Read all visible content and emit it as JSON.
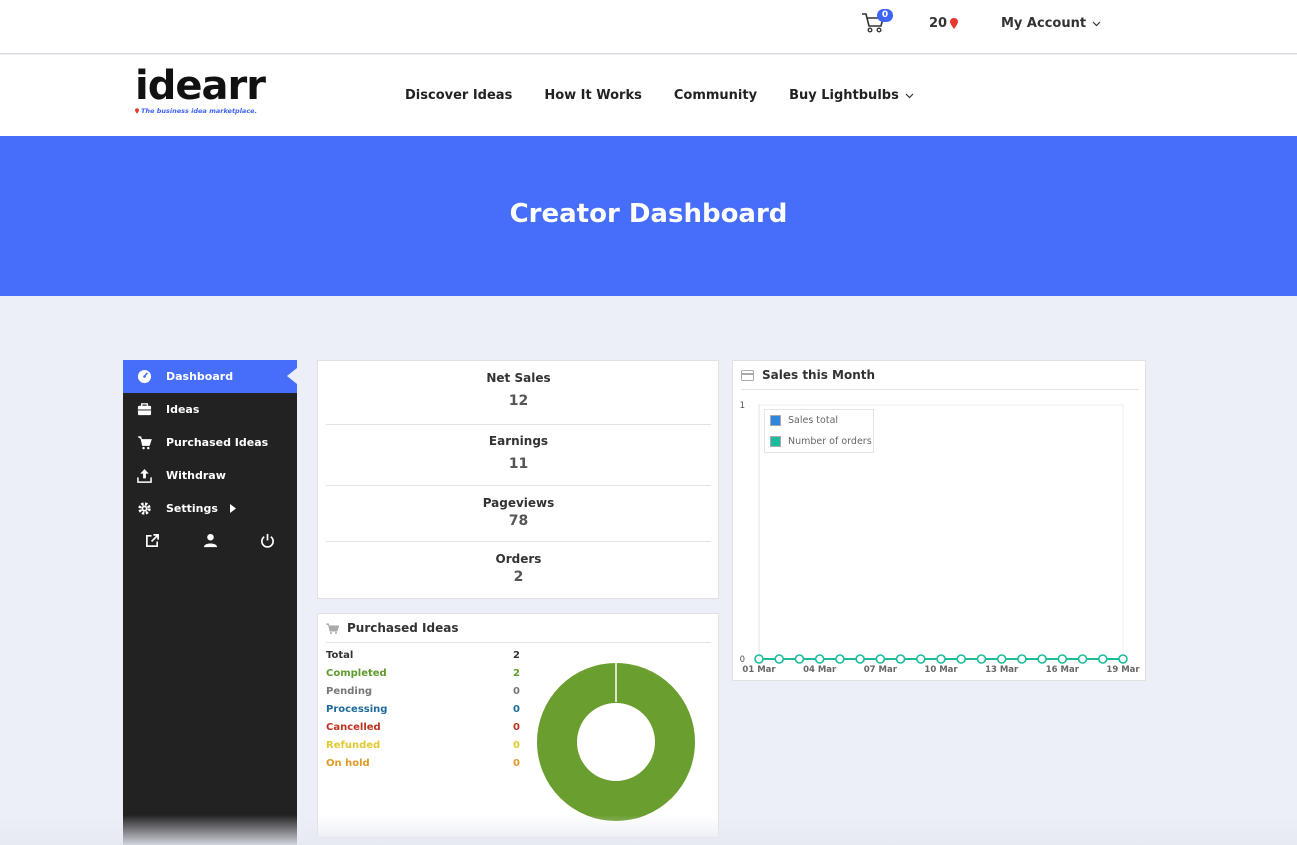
{
  "topbar": {
    "cart_count": "0",
    "lightbulbs": "20",
    "account_label": "My Account"
  },
  "brand": {
    "logo_text": "idearr",
    "tagline": "The business idea marketplace."
  },
  "nav": {
    "items": [
      {
        "label": "Discover Ideas"
      },
      {
        "label": "How It Works"
      },
      {
        "label": "Community"
      },
      {
        "label": "Buy Lightbulbs"
      }
    ]
  },
  "hero": {
    "title": "Creator Dashboard"
  },
  "sidebar": {
    "items": [
      {
        "label": "Dashboard",
        "icon": "dashboard-icon"
      },
      {
        "label": "Ideas",
        "icon": "briefcase-icon"
      },
      {
        "label": "Purchased Ideas",
        "icon": "cart-icon"
      },
      {
        "label": "Withdraw",
        "icon": "upload-icon"
      },
      {
        "label": "Settings",
        "icon": "gear-icon"
      }
    ],
    "footer_icons": [
      "external-link-icon",
      "user-icon",
      "power-icon"
    ]
  },
  "stats": {
    "items": [
      {
        "label": "Net Sales",
        "value": "12"
      },
      {
        "label": "Earnings",
        "value": "11"
      },
      {
        "label": "Pageviews",
        "value": "78"
      },
      {
        "label": "Orders",
        "value": "2"
      }
    ]
  },
  "purchased": {
    "title": "Purchased Ideas",
    "rows": [
      {
        "label": "Total",
        "value": "2",
        "color": "#333333"
      },
      {
        "label": "Completed",
        "value": "2",
        "color": "#5f9a2a"
      },
      {
        "label": "Pending",
        "value": "0",
        "color": "#777777"
      },
      {
        "label": "Processing",
        "value": "0",
        "color": "#1e6b9a"
      },
      {
        "label": "Cancelled",
        "value": "0",
        "color": "#c0321e"
      },
      {
        "label": "Refunded",
        "value": "0",
        "color": "#e2c931"
      },
      {
        "label": "On hold",
        "value": "0",
        "color": "#e09a2a"
      }
    ],
    "donut_color": "#6a9e2f"
  },
  "sales": {
    "title": "Sales this Month",
    "legend": [
      {
        "label": "Sales total",
        "color": "#2e86de"
      },
      {
        "label": "Number of orders",
        "color": "#1abc9c"
      }
    ]
  },
  "chart_data": {
    "type": "line",
    "title": "Sales this Month",
    "x": [
      "01 Mar",
      "02 Mar",
      "03 Mar",
      "04 Mar",
      "05 Mar",
      "06 Mar",
      "07 Mar",
      "08 Mar",
      "09 Mar",
      "10 Mar",
      "11 Mar",
      "12 Mar",
      "13 Mar",
      "14 Mar",
      "15 Mar",
      "16 Mar",
      "17 Mar",
      "18 Mar",
      "19 Mar"
    ],
    "tick_labels": [
      "01 Mar",
      "04 Mar",
      "07 Mar",
      "10 Mar",
      "13 Mar",
      "16 Mar",
      "19 Mar"
    ],
    "series": [
      {
        "name": "Sales total",
        "values": [
          0,
          0,
          0,
          0,
          0,
          0,
          0,
          0,
          0,
          0,
          0,
          0,
          0,
          0,
          0,
          0,
          0,
          0,
          0
        ]
      },
      {
        "name": "Number of orders",
        "values": [
          0,
          0,
          0,
          0,
          0,
          0,
          0,
          0,
          0,
          0,
          0,
          0,
          0,
          0,
          0,
          0,
          0,
          0,
          0
        ]
      }
    ],
    "ylim": [
      0,
      1
    ],
    "yticks": [
      "0",
      "1"
    ],
    "xlabel": "",
    "ylabel": "",
    "legend_position": "top-left",
    "grid": false
  }
}
